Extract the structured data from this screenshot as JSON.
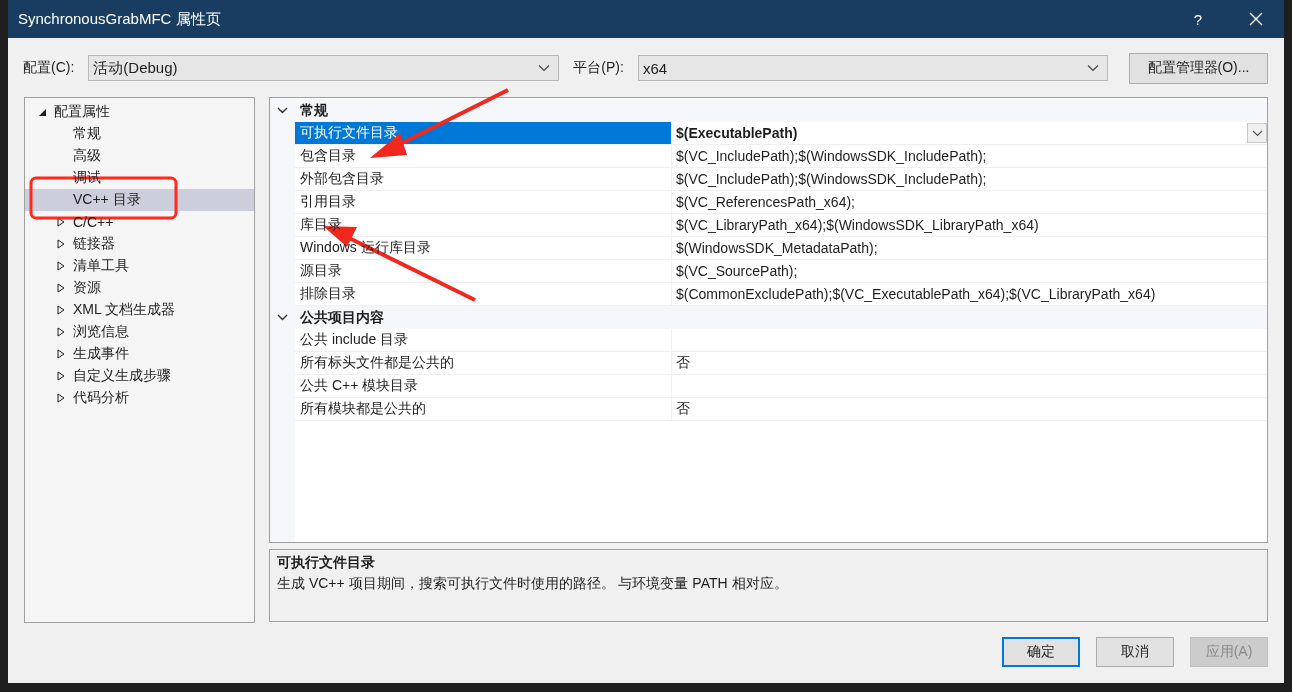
{
  "window": {
    "title": "SynchronousGrabMFC 属性页",
    "help": "?"
  },
  "config_bar": {
    "configuration_label": "配置(C):",
    "configuration_value": "活动(Debug)",
    "platform_label": "平台(P):",
    "platform_value": "x64",
    "manager_button": "配置管理器(O)..."
  },
  "tree": [
    {
      "label": "配置属性",
      "kind": "group",
      "expanded": true,
      "selected": false,
      "children": [
        {
          "label": "常规",
          "kind": "page",
          "selected": false
        },
        {
          "label": "高级",
          "kind": "page",
          "selected": false
        },
        {
          "label": "调试",
          "kind": "page",
          "selected": false
        },
        {
          "label": "VC++ 目录",
          "kind": "page",
          "selected": true
        },
        {
          "label": "C/C++",
          "kind": "group",
          "expanded": false,
          "selected": false
        },
        {
          "label": "链接器",
          "kind": "group",
          "expanded": false,
          "selected": false
        },
        {
          "label": "清单工具",
          "kind": "group",
          "expanded": false,
          "selected": false
        },
        {
          "label": "资源",
          "kind": "group",
          "expanded": false,
          "selected": false
        },
        {
          "label": "XML 文档生成器",
          "kind": "group",
          "expanded": false,
          "selected": false
        },
        {
          "label": "浏览信息",
          "kind": "group",
          "expanded": false,
          "selected": false
        },
        {
          "label": "生成事件",
          "kind": "group",
          "expanded": false,
          "selected": false
        },
        {
          "label": "自定义生成步骤",
          "kind": "group",
          "expanded": false,
          "selected": false
        },
        {
          "label": "代码分析",
          "kind": "group",
          "expanded": false,
          "selected": false
        }
      ]
    }
  ],
  "property_grid": [
    {
      "category": "常规",
      "expanded": true,
      "rows": [
        {
          "name": "可执行文件目录",
          "value": "$(ExecutablePath)",
          "selected": true
        },
        {
          "name": "包含目录",
          "value": "$(VC_IncludePath);$(WindowsSDK_IncludePath);",
          "selected": false
        },
        {
          "name": "外部包含目录",
          "value": "$(VC_IncludePath);$(WindowsSDK_IncludePath);",
          "selected": false
        },
        {
          "name": "引用目录",
          "value": "$(VC_ReferencesPath_x64);",
          "selected": false
        },
        {
          "name": "库目录",
          "value": "$(VC_LibraryPath_x64);$(WindowsSDK_LibraryPath_x64)",
          "selected": false
        },
        {
          "name": "Windows 运行库目录",
          "value": "$(WindowsSDK_MetadataPath);",
          "selected": false
        },
        {
          "name": "源目录",
          "value": "$(VC_SourcePath);",
          "selected": false
        },
        {
          "name": "排除目录",
          "value": "$(CommonExcludePath);$(VC_ExecutablePath_x64);$(VC_LibraryPath_x64)",
          "selected": false
        }
      ]
    },
    {
      "category": "公共项目内容",
      "expanded": true,
      "rows": [
        {
          "name": "公共 include 目录",
          "selected": false
        },
        {
          "name": "所有标头文件都是公共的",
          "value": "否",
          "selected": false
        },
        {
          "name": "公共 C++ 模块目录",
          "selected": false
        },
        {
          "name": "所有模块都是公共的",
          "value": "否",
          "selected": false
        }
      ]
    }
  ],
  "description": {
    "title": "可执行文件目录",
    "text": "生成 VC++ 项目期间，搜索可执行文件时使用的路径。 与环境变量 PATH 相对应。"
  },
  "buttons": [
    {
      "label": "确定",
      "kind": "default",
      "disabled": false
    },
    {
      "label": "取消",
      "kind": "normal",
      "disabled": false
    },
    {
      "label": "应用(A)",
      "kind": "normal",
      "disabled": true
    }
  ]
}
